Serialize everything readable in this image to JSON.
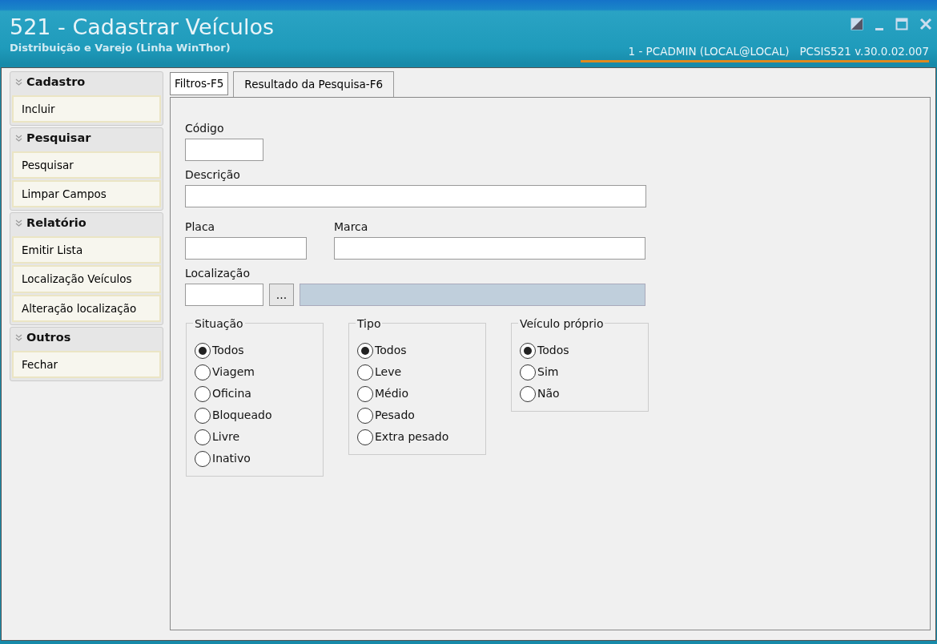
{
  "window": {
    "title": "521 - Cadastrar Veículos",
    "subtitle": "Distribuição e Varejo (Linha WinThor)",
    "session": "1 - PCADMIN (LOCAL@LOCAL)",
    "version": "PCSIS521  v.30.0.02.007"
  },
  "sidebar": [
    {
      "title": "Cadastro",
      "items": [
        "Incluir"
      ]
    },
    {
      "title": "Pesquisar",
      "items": [
        "Pesquisar",
        "Limpar Campos"
      ]
    },
    {
      "title": "Relatório",
      "items": [
        "Emitir Lista",
        "Localização Veículos",
        "Alteração localização"
      ]
    },
    {
      "title": "Outros",
      "items": [
        "Fechar"
      ]
    }
  ],
  "tabs": [
    {
      "label": "Filtros-F5",
      "selected": true
    },
    {
      "label": "Resultado da Pesquisa-F6",
      "selected": false
    }
  ],
  "fields": {
    "codigo": "Código",
    "descricao": "Descrição",
    "placa": "Placa",
    "marca": "Marca",
    "localizacao": "Localização",
    "browse": "..."
  },
  "groups": [
    {
      "title": "Situação",
      "options": [
        {
          "label": "Todos",
          "selected": true
        },
        {
          "label": "Viagem",
          "selected": false
        },
        {
          "label": "Oficina",
          "selected": false
        },
        {
          "label": "Bloqueado",
          "selected": false
        },
        {
          "label": "Livre",
          "selected": false
        },
        {
          "label": "Inativo",
          "selected": false
        }
      ]
    },
    {
      "title": "Tipo",
      "options": [
        {
          "label": "Todos",
          "selected": true
        },
        {
          "label": "Leve",
          "selected": false
        },
        {
          "label": "Médio",
          "selected": false
        },
        {
          "label": "Pesado",
          "selected": false
        },
        {
          "label": "Extra pesado",
          "selected": false
        }
      ]
    },
    {
      "title": "Veículo próprio",
      "options": [
        {
          "label": "Todos",
          "selected": true
        },
        {
          "label": "Sim",
          "selected": false
        },
        {
          "label": "Não",
          "selected": false
        }
      ]
    }
  ]
}
